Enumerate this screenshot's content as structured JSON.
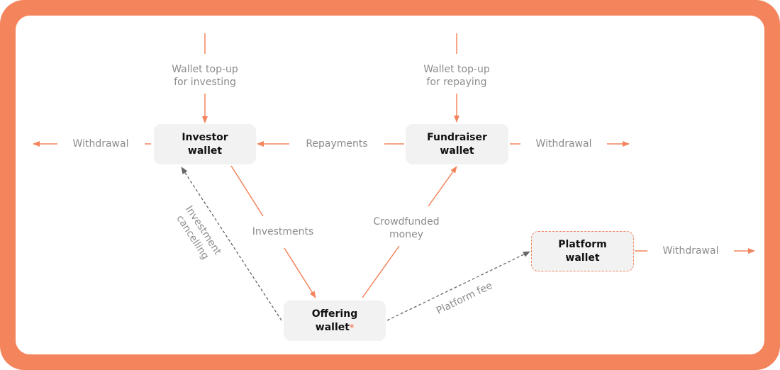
{
  "colors": {
    "accent": "#f4845c",
    "node_fill": "#f2f2f2",
    "label_text": "#8c8c8c",
    "dashed_arrow": "#666666"
  },
  "nodes": {
    "investor": {
      "line1": "Investor",
      "line2": "wallet"
    },
    "fundraiser": {
      "line1": "Fundraiser",
      "line2": "wallet"
    },
    "offering": {
      "line1": "Offering",
      "line2": "wallet",
      "marker": "*"
    },
    "platform": {
      "line1": "Platform",
      "line2": "wallet"
    }
  },
  "labels": {
    "topup_investing": {
      "line1": "Wallet top-up",
      "line2": "for investing"
    },
    "topup_repaying": {
      "line1": "Wallet top-up",
      "line2": "for repaying"
    },
    "withdrawal_investor": "Withdrawal",
    "repayments": "Repayments",
    "withdrawal_fundraiser": "Withdrawal",
    "investments": "Investments",
    "crowdfunded": {
      "line1": "Crowdfunded",
      "line2": "money"
    },
    "investment_cancelling": {
      "line1": "Investment",
      "line2": "cancelling"
    },
    "platform_fee": "Platform fee",
    "withdrawal_platform": "Withdrawal"
  }
}
